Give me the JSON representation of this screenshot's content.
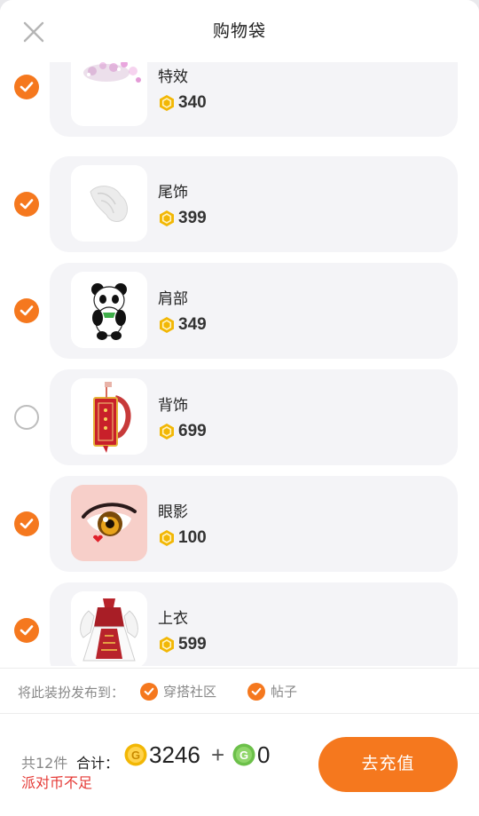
{
  "header": {
    "title": "购物袋"
  },
  "items": [
    {
      "name": "特效",
      "price": "340",
      "checked": true,
      "thumb": "sparkle-effect"
    },
    {
      "name": "尾饰",
      "price": "399",
      "checked": true,
      "thumb": "white-fur-tail"
    },
    {
      "name": "肩部",
      "price": "349",
      "checked": true,
      "thumb": "panda-shoulder"
    },
    {
      "name": "背饰",
      "price": "699",
      "checked": false,
      "thumb": "red-lantern-banner"
    },
    {
      "name": "眼影",
      "price": "100",
      "checked": true,
      "thumb": "anime-eye"
    },
    {
      "name": "上衣",
      "price": "599",
      "checked": true,
      "thumb": "red-white-dress"
    }
  ],
  "share": {
    "label": "将此装扮发布到：",
    "options": [
      {
        "label": "穿搭社区",
        "checked": true
      },
      {
        "label": "帖子",
        "checked": true
      }
    ]
  },
  "footer": {
    "count": "共12件",
    "total_label": "合计：",
    "coin_total": "3246",
    "plus": "+",
    "g_total": "0",
    "warning": "派对币不足",
    "recharge_label": "去充值"
  },
  "colors": {
    "accent": "#f5781e",
    "coin": "#f2b705",
    "g_coin": "#6cc04a",
    "warning": "#e53935"
  }
}
